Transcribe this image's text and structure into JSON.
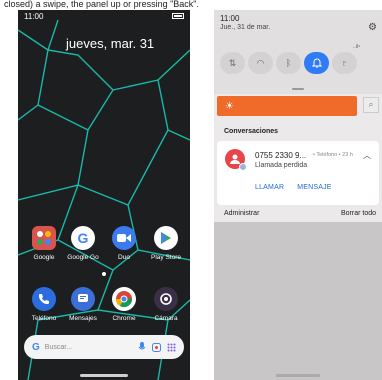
{
  "caption": "closed) a swipe, the panel up or pressing \"Back\".",
  "left_phone": {
    "status_time": "11:00",
    "date": "jueves, mar. 31",
    "apps_row1": [
      {
        "label": "Google",
        "icon": "google-folder-icon",
        "color": "#d9544e"
      },
      {
        "label": "Google Go",
        "icon": "google-go-icon",
        "color": "#ffffff"
      },
      {
        "label": "Duo",
        "icon": "duo-icon",
        "color": "#3b7bef"
      },
      {
        "label": "Play Store",
        "icon": "play-store-icon",
        "color": "#ffffff"
      }
    ],
    "apps_row2": [
      {
        "label": "Teléfono",
        "icon": "phone-icon",
        "color": "#2d6cdf"
      },
      {
        "label": "Mensajes",
        "icon": "messages-icon",
        "color": "#3b6fd8"
      },
      {
        "label": "Chrome",
        "icon": "chrome-icon",
        "color": "#ffffff"
      },
      {
        "label": "Cámara",
        "icon": "camera-icon",
        "color": "#3a2f45"
      }
    ],
    "search_placeholder": "Buscar..."
  },
  "right_phone": {
    "status_time": "11:00",
    "status_date": "Jue., 31 de mar.",
    "signal": "..il⁴",
    "tiles": [
      {
        "name": "data-toggle",
        "on": false,
        "glyph": "⇅"
      },
      {
        "name": "wifi-toggle",
        "on": false,
        "glyph": "◠"
      },
      {
        "name": "bluetooth-toggle",
        "on": false,
        "glyph": "ᛒ"
      },
      {
        "name": "dnd-toggle",
        "on": true,
        "glyph": "🔔"
      },
      {
        "name": "flashlight-toggle",
        "on": false,
        "glyph": "♇"
      }
    ],
    "section_title": "Conversaciones",
    "notification": {
      "title": "0755 2330 9...",
      "meta": "• Teléfono • 23 h",
      "subtitle": "Llamada perdida",
      "action_call": "LLAMAR",
      "action_message": "MENSAJE"
    },
    "manage_label": "Administrar",
    "clear_all_label": "Borrar todo"
  },
  "colors": {
    "accent_blue": "#2f7cf6",
    "brightness_orange": "#f06a2a",
    "avatar_red": "#e8444a"
  }
}
